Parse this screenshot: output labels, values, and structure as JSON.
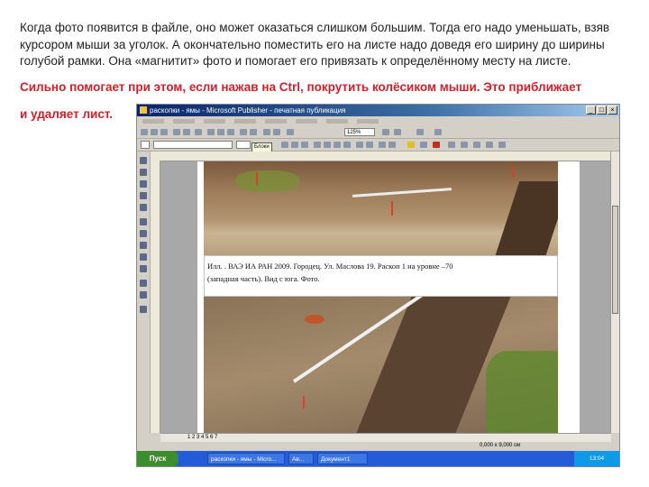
{
  "instruction": {
    "paragraph": "Когда фото появится в файле, оно может оказаться слишком большим. Тогда его надо уменьшать, взяв курсором мыши за уголок. А окончательно поместить его на листе надо доведя его ширину до ширины голубой рамки. Она «магнитит» фото и помогает его привязать к определённому месту на листе.",
    "highlight_line1": "Сильно помогает при этом, если нажав на Ctrl, покрутить колёсиком мыши. Это приближает",
    "highlight_line2": "и удаляет лист."
  },
  "screenshot": {
    "window_title": "раскопки - ямы - Microsoft Publisher - печатная публикация",
    "zoom": "125%",
    "tooltip": "Блоки",
    "caption_line1": "Илл.     . ВАЭ ИА РАН 2009. Городец. Ул. Маслова 19. Раскоп 1 на уровне –70",
    "caption_line2": "(западная часть). Вид с юга. Фото.",
    "page_tabs": "1  2  3  4  5  6  7",
    "status_left": "",
    "status_right": "0,000 x 9,000 см",
    "taskbar": {
      "start": "Пуск",
      "task1": "раскопки - ямы - Micro...",
      "task2": "Ав...",
      "task3": "Документ1",
      "clock": "13:04"
    },
    "colors": {
      "highlight_text": "#d0202a",
      "title_bar": "#0a246a",
      "taskbar": "#235bd8"
    }
  }
}
